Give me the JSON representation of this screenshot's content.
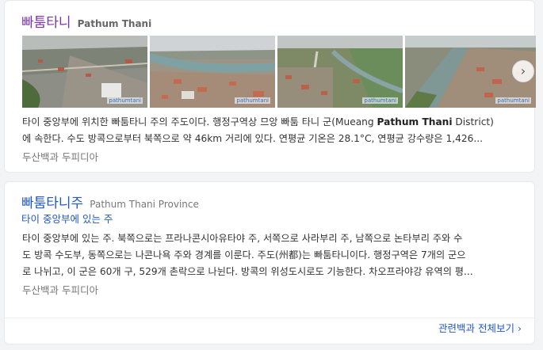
{
  "card1": {
    "title": "빠툼타니",
    "title_en": "Pathum Thani",
    "image_watermarks": [
      "pathumtani",
      "pathumtani",
      "pathumtani",
      "pathumtani"
    ],
    "next_icon": "›",
    "desc_line1_pre": "타이 중앙부에 위치한 빠툼타니 주의 주도이다. 행정구역상 므앙 빠툼 타니 군(Mueang ",
    "desc_line1_bold": "Pathum Thani",
    "desc_line1_post": " District)",
    "desc_line2": "에 속한다. 수도 방콕으로부터 북쪽으로 약 46km 거리에 있다. 연평균 기온은 28.1°C, 연평균 강수량은 1,426...",
    "source": "두산백과 두피디아"
  },
  "card2": {
    "title": "빠툼타니주",
    "title_en": "Pathum Thani Province",
    "subtitle": "타이 중앙부에 있는 주",
    "desc_line1": "타이 중앙부에 있는 주. 북쪽으로는 프라나콘시아유타야 주, 서쪽으로 사라부리 주, 남쪽으로 논타부리 주와 수",
    "desc_line2": "도 방콕 수도부, 동쪽으로는 나콘나욕 주와 경계를 이룬다. 주도(州都)는 빠툼타니이다. 행정구역은 7개의 군으",
    "desc_line3": "로 나뉘고, 이 군은 60개 구, 529개 촌락으로 나뉜다. 방콕의 위성도시로도 기능한다. 차오프라야강 유역의 평...",
    "source": "두산백과 두피디아",
    "more_link": "관련백과 전체보기 ›"
  }
}
